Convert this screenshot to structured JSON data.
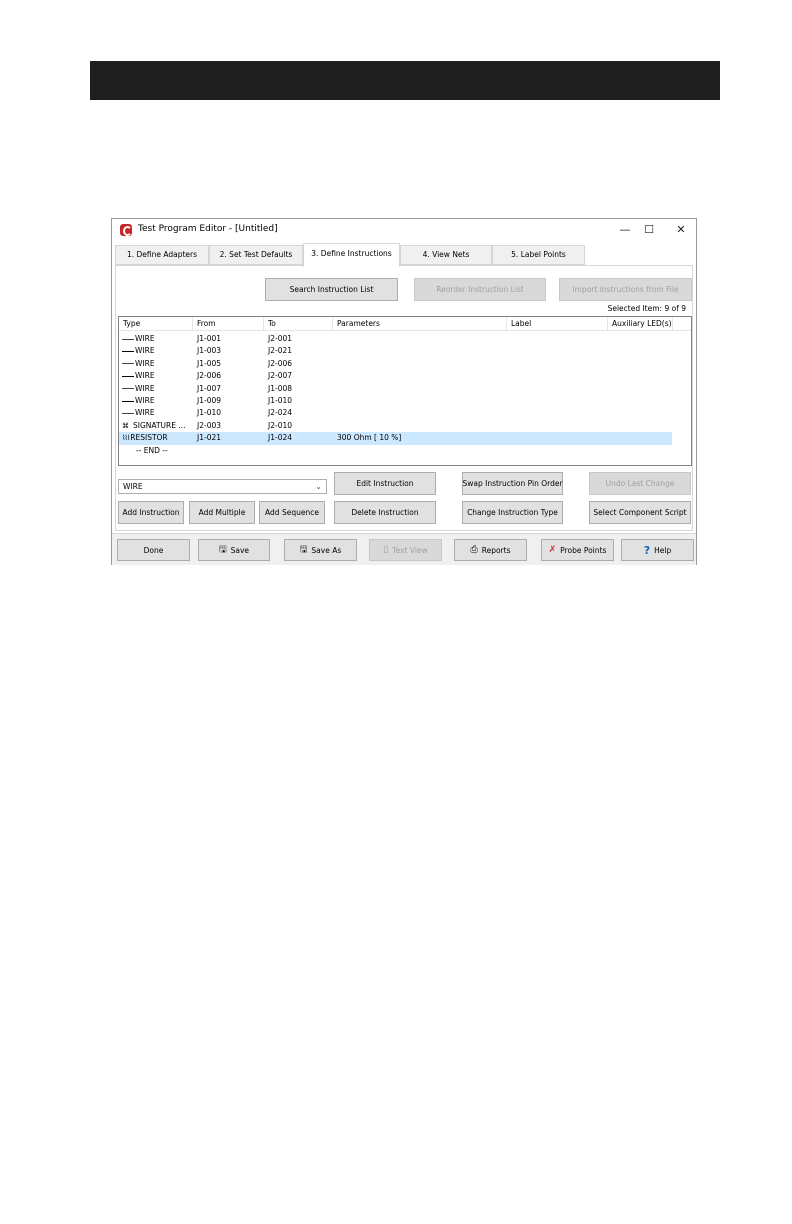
{
  "window": {
    "title": "Test Program Editor - [Untitled]",
    "minimize": "—",
    "maximize": "☐",
    "close": "✕"
  },
  "tabs": [
    {
      "label": "1. Define Adapters"
    },
    {
      "label": "2. Set Test Defaults"
    },
    {
      "label": "3. Define Instructions",
      "active": true
    },
    {
      "label": "4. View Nets"
    },
    {
      "label": "5. Label Points"
    }
  ],
  "toolbar": {
    "search": "Search Instruction List",
    "reorder": "Reorder Instruction List",
    "import": "Import Instructions from File"
  },
  "selected_item": "Selected Item: 9 of 9",
  "columns": [
    "Type",
    "From",
    "To",
    "Parameters",
    "Label",
    "Auxiliary LED(s)"
  ],
  "rows": [
    {
      "type": "WIRE",
      "from": "J1-001",
      "to": "J2-001",
      "params": "",
      "icon": "wire-icon"
    },
    {
      "type": "WIRE",
      "from": "J1-003",
      "to": "J2-021",
      "params": "",
      "icon": "wire-icon"
    },
    {
      "type": "WIRE",
      "from": "J1-005",
      "to": "J2-006",
      "params": "",
      "icon": "wire-icon"
    },
    {
      "type": "WIRE",
      "from": "J2-006",
      "to": "J2-007",
      "params": "",
      "icon": "wire-icon"
    },
    {
      "type": "WIRE",
      "from": "J1-007",
      "to": "J1-008",
      "params": "",
      "icon": "wire-icon"
    },
    {
      "type": "WIRE",
      "from": "J1-009",
      "to": "J1-010",
      "params": "",
      "icon": "wire-icon"
    },
    {
      "type": "WIRE",
      "from": "J1-010",
      "to": "J2-024",
      "params": "",
      "icon": "wire-icon"
    },
    {
      "type": "SIGNATURE ...",
      "from": "J2-003",
      "to": "J2-010",
      "params": "",
      "icon": "signature-icon"
    },
    {
      "type": "RESISTOR",
      "from": "J1-021",
      "to": "J1-024",
      "params": "300 Ohm [ 10 %]",
      "icon": "resistor-icon",
      "selected": true
    },
    {
      "type": "-- END --",
      "from": "",
      "to": "",
      "params": "",
      "icon": ""
    }
  ],
  "combo": {
    "value": "WIRE"
  },
  "actions": {
    "add_instruction": "Add Instruction",
    "add_multiple": "Add Multiple",
    "add_sequence": "Add Sequence",
    "edit_instruction": "Edit Instruction",
    "delete_instruction": "Delete Instruction",
    "swap_pin_order": "Swap Instruction Pin Order",
    "change_type": "Change Instruction Type",
    "undo_last": "Undo Last Change",
    "select_script": "Select Component Script"
  },
  "bottom": {
    "done": "Done",
    "save": "Save",
    "save_as": "Save As",
    "text_view": "Text View",
    "reports": "Reports",
    "probe_points": "Probe Points",
    "help": "Help"
  },
  "colors": {
    "selected_row": "#cce8ff",
    "top_bar": "#1e1e1e",
    "app_icon": "#c62828"
  }
}
